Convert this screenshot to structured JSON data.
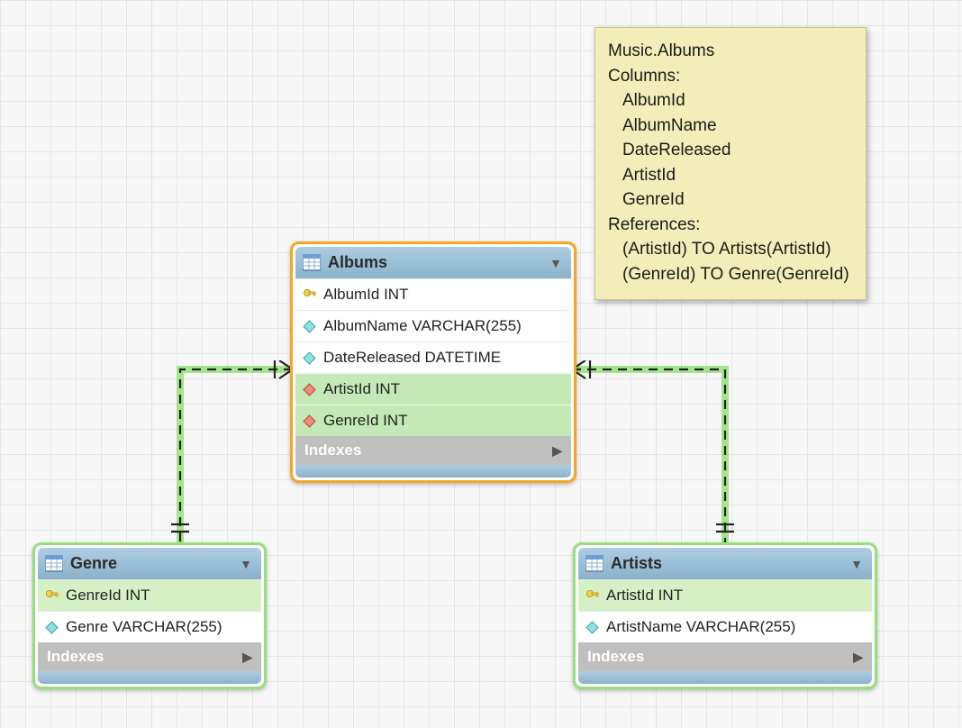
{
  "tooltip": {
    "title": "Music.Albums",
    "columns_label": "Columns:",
    "columns": [
      "AlbumId",
      "AlbumName",
      "DateReleased",
      "ArtistId",
      "GenreId"
    ],
    "references_label": "References:",
    "references": [
      "(ArtistId) TO Artists(ArtistId)",
      "(GenreId) TO Genre(GenreId)"
    ]
  },
  "tables": {
    "albums": {
      "title": "Albums",
      "columns": [
        {
          "name": "AlbumId INT",
          "role": "pk"
        },
        {
          "name": "AlbumName VARCHAR(255)",
          "role": "col"
        },
        {
          "name": "DateReleased DATETIME",
          "role": "col"
        },
        {
          "name": "ArtistId INT",
          "role": "fk"
        },
        {
          "name": "GenreId INT",
          "role": "fk"
        }
      ],
      "indexes_label": "Indexes"
    },
    "genre": {
      "title": "Genre",
      "columns": [
        {
          "name": "GenreId INT",
          "role": "pk"
        },
        {
          "name": "Genre VARCHAR(255)",
          "role": "col"
        }
      ],
      "indexes_label": "Indexes"
    },
    "artists": {
      "title": "Artists",
      "columns": [
        {
          "name": "ArtistId INT",
          "role": "pk"
        },
        {
          "name": "ArtistName VARCHAR(255)",
          "role": "col"
        }
      ],
      "indexes_label": "Indexes"
    }
  }
}
